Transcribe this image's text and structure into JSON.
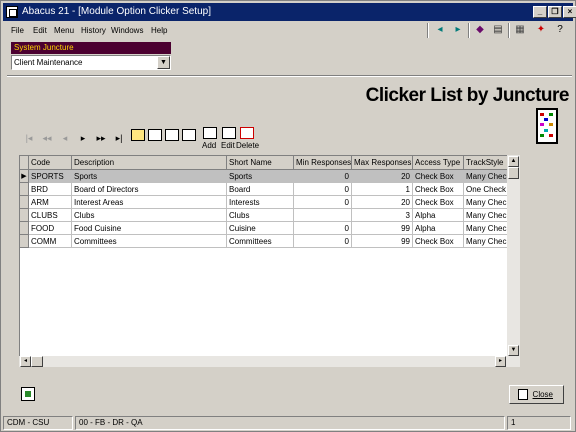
{
  "window": {
    "title": "Abacus 21 - [Module Option Clicker Setup]",
    "controls": {
      "minimize": "_",
      "restore": "❐",
      "close": "×"
    }
  },
  "menu": [
    "File",
    "Edit",
    "Menu",
    "History",
    "Windows",
    "Help"
  ],
  "toolbar_icons": [
    "arrow-left-icon",
    "arrow-right-icon",
    "bookmark-icon",
    "calculator-icon",
    "run-icon",
    "help-icon"
  ],
  "juncture": {
    "label": "System Juncture",
    "value": "Client Maintenance"
  },
  "page_title": "Clicker List by Juncture",
  "nav": {
    "add_label": "Add",
    "edit_label": "Edit",
    "delete_label": "Delete"
  },
  "grid": {
    "columns": [
      "Code",
      "Description",
      "Short Name",
      "Min Responses",
      "Max Responses",
      "Access Type",
      "TrackStyle"
    ],
    "rows": [
      {
        "code": "SPORTS",
        "description": "Sports",
        "short_name": "Sports",
        "min": "0",
        "max": "20",
        "access": "Check Box",
        "track": "Many Check"
      },
      {
        "code": "BRD",
        "description": "Board of Directors",
        "short_name": "Board",
        "min": "0",
        "max": "1",
        "access": "Check Box",
        "track": "One Check"
      },
      {
        "code": "ARM",
        "description": "Interest Areas",
        "short_name": "Interests",
        "min": "0",
        "max": "20",
        "access": "Check Box",
        "track": "Many Check"
      },
      {
        "code": "CLUBS",
        "description": "Clubs",
        "short_name": "Clubs",
        "min": "",
        "max": "3",
        "access": "Alpha",
        "track": "Many Check"
      },
      {
        "code": "FOOD",
        "description": "Food Cuisine",
        "short_name": "Cuisine",
        "min": "0",
        "max": "99",
        "access": "Alpha",
        "track": "Many Check"
      },
      {
        "code": "COMM",
        "description": "Committees",
        "short_name": "Committees",
        "min": "0",
        "max": "99",
        "access": "Check Box",
        "track": "Many Check"
      }
    ],
    "selected_row": 0
  },
  "close_label": "Close",
  "status": [
    "CDM - CSU",
    "00 - FB - DR - QA",
    "1"
  ]
}
